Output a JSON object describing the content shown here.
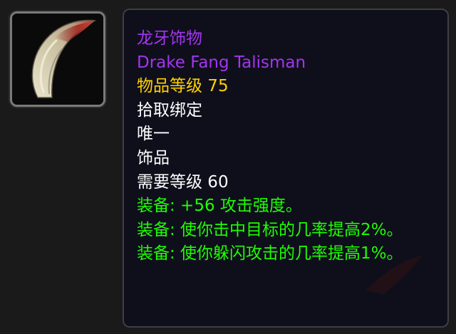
{
  "icon": {
    "name": "drake-fang-icon"
  },
  "tooltip": {
    "name_cn": "龙牙饰物",
    "name_en": "Drake Fang Talisman",
    "item_level": "物品等级 75",
    "bind": "拾取绑定",
    "unique": "唯一",
    "slot": "饰品",
    "required_level": "需要等级 60",
    "effects": [
      "装备: +56 攻击强度。",
      "装备: 使你击中目标的几率提高2%。",
      "装备: 使你躲闪攻击的几率提高1%。"
    ]
  },
  "colors": {
    "epic": "#a335ee",
    "item_level": "#ffd100",
    "white": "#ffffff",
    "effect_green": "#1eff00",
    "background": "#1a1a1a",
    "tooltip_bg": "#0f0f1c"
  }
}
